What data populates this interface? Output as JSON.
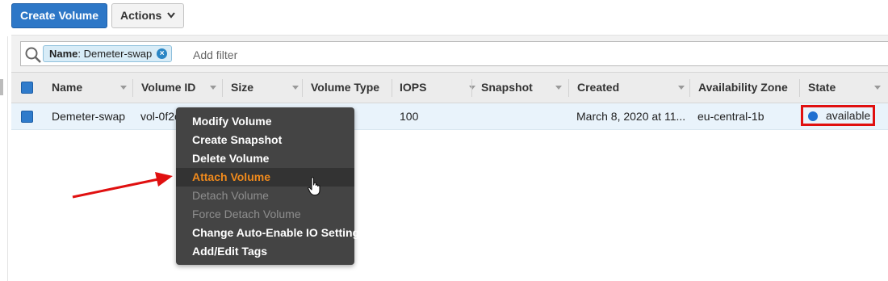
{
  "toolbar": {
    "create_label": "Create Volume",
    "actions_label": "Actions"
  },
  "filter": {
    "token_key": "Name",
    "token_value": ": Demeter-swap",
    "add_placeholder": "Add filter"
  },
  "table": {
    "columns": [
      "Name",
      "Volume ID",
      "Size",
      "Volume Type",
      "IOPS",
      "Snapshot",
      "Created",
      "Availability Zone",
      "State"
    ],
    "rows": [
      {
        "name": "Demeter-swap",
        "volume_id": "vol-0f2c",
        "size": "",
        "volume_type": "",
        "iops": "100",
        "snapshot": "",
        "created": "March 8, 2020 at 11...",
        "zone": "eu-central-1b",
        "state": "available"
      }
    ]
  },
  "context_menu": {
    "items": [
      {
        "label": "Modify Volume",
        "state": "enabled"
      },
      {
        "label": "Create Snapshot",
        "state": "enabled"
      },
      {
        "label": "Delete Volume",
        "state": "enabled"
      },
      {
        "label": "Attach Volume",
        "state": "highlighted"
      },
      {
        "label": "Detach Volume",
        "state": "disabled"
      },
      {
        "label": "Force Detach Volume",
        "state": "disabled"
      },
      {
        "label": "Change Auto-Enable IO Setting",
        "state": "enabled"
      },
      {
        "label": "Add/Edit Tags",
        "state": "enabled"
      }
    ]
  },
  "colors": {
    "primary_button": "#2d77c7",
    "highlight_text": "#f08a1c",
    "annotation_red": "#e01010",
    "state_dot": "#1f6fd0"
  },
  "icons": [
    "search-icon",
    "close-icon",
    "chevron-down-icon",
    "hand-pointer-icon",
    "annotation-arrow-icon"
  ]
}
